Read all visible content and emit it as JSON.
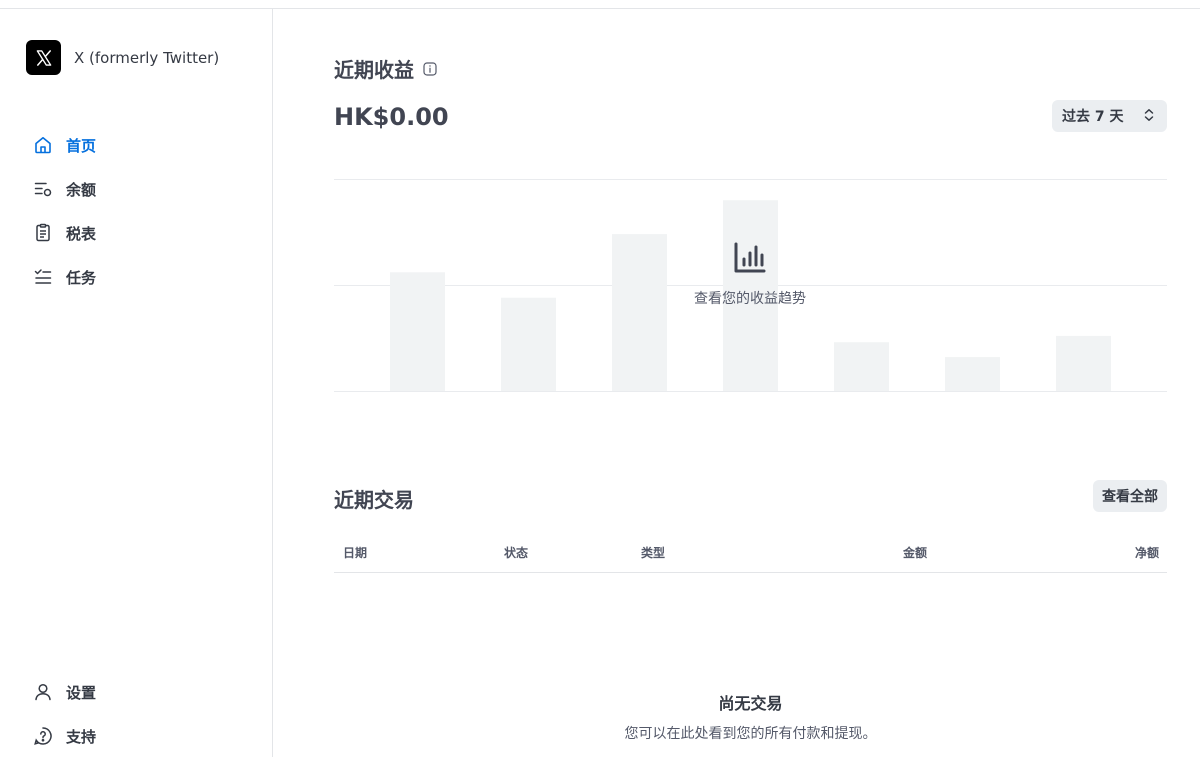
{
  "app": {
    "name": "X (formerly Twitter)",
    "logo_icon": "x-logo-icon"
  },
  "sidebar": {
    "items": [
      {
        "label": "首页",
        "icon": "home-icon",
        "active": true
      },
      {
        "label": "余额",
        "icon": "balance-icon",
        "active": false
      },
      {
        "label": "税表",
        "icon": "tax-form-icon",
        "active": false
      },
      {
        "label": "任务",
        "icon": "tasks-icon",
        "active": false
      }
    ],
    "bottom_items": [
      {
        "label": "设置",
        "icon": "user-icon"
      },
      {
        "label": "支持",
        "icon": "help-icon"
      }
    ]
  },
  "earnings": {
    "title": "近期收益",
    "info_icon": "info-icon",
    "amount": "HK$0.00",
    "range": "过去 7 天",
    "range_icon": "chevron-up-down-icon",
    "chart_empty_message": "查看您的收益趋势",
    "chart_icon": "bar-chart-icon"
  },
  "chart_data": {
    "type": "bar",
    "note": "placeholder skeleton bars (no real data)",
    "categories": [
      "",
      "",
      "",
      "",
      "",
      "",
      ""
    ],
    "values": [
      56,
      44,
      74,
      90,
      23,
      16,
      26
    ],
    "ylim": [
      0,
      100
    ],
    "grid": true,
    "color": "#f1f3f4"
  },
  "transactions": {
    "title": "近期交易",
    "view_all_label": "查看全部",
    "columns": [
      "日期",
      "状态",
      "类型",
      "金额",
      "净额"
    ],
    "empty_title": "尚无交易",
    "empty_subtitle": "您可以在此处看到您的所有付款和提现。"
  },
  "colors": {
    "accent": "#0570de",
    "text": "#353a44",
    "placeholder_bar": "#f1f3f4",
    "button_bg": "#ebeef1"
  }
}
